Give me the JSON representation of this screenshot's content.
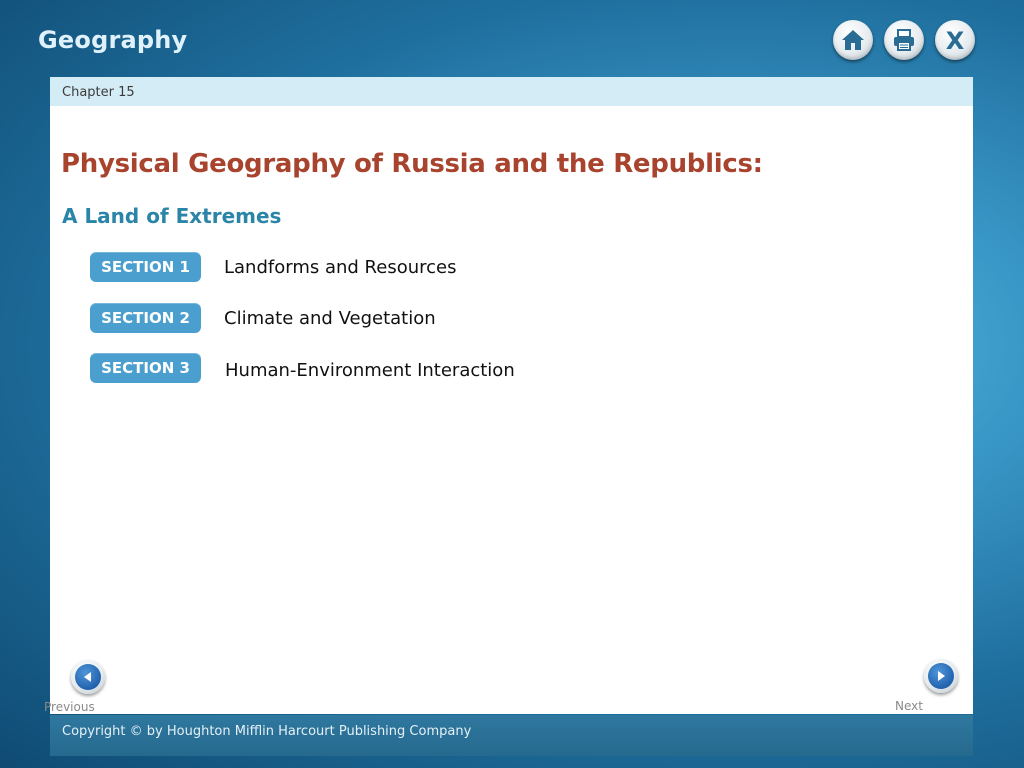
{
  "header": {
    "app_title": "Geography",
    "buttons": [
      {
        "icon": "home-icon"
      },
      {
        "icon": "printer-icon"
      },
      {
        "icon": "close-icon",
        "label": "X"
      }
    ]
  },
  "chapter": {
    "label": "Chapter 15"
  },
  "main": {
    "title": "Physical Geography of Russia and the Republics:",
    "subtitle": "A Land of Extremes",
    "sections": [
      {
        "badge": "SECTION 1",
        "label": "Landforms and Resources"
      },
      {
        "badge": "SECTION 2",
        "label": "Climate and Vegetation"
      },
      {
        "badge": "SECTION 3",
        "label": "Human-Environment Interaction"
      }
    ]
  },
  "nav": {
    "previous_label": "Previous",
    "next_label": "Next"
  },
  "footer": {
    "copyright": "Copyright © by Houghton Mifflin Harcourt Publishing Company"
  },
  "colors": {
    "title": "#a8442e",
    "subtitle": "#2b85a8",
    "badge": "#4a9fcf",
    "chapter_bar": "#d4ecf6",
    "footer_bar": "#2a6f95",
    "icon": "#2a6d94",
    "nav_arrow": "#2262ae"
  }
}
